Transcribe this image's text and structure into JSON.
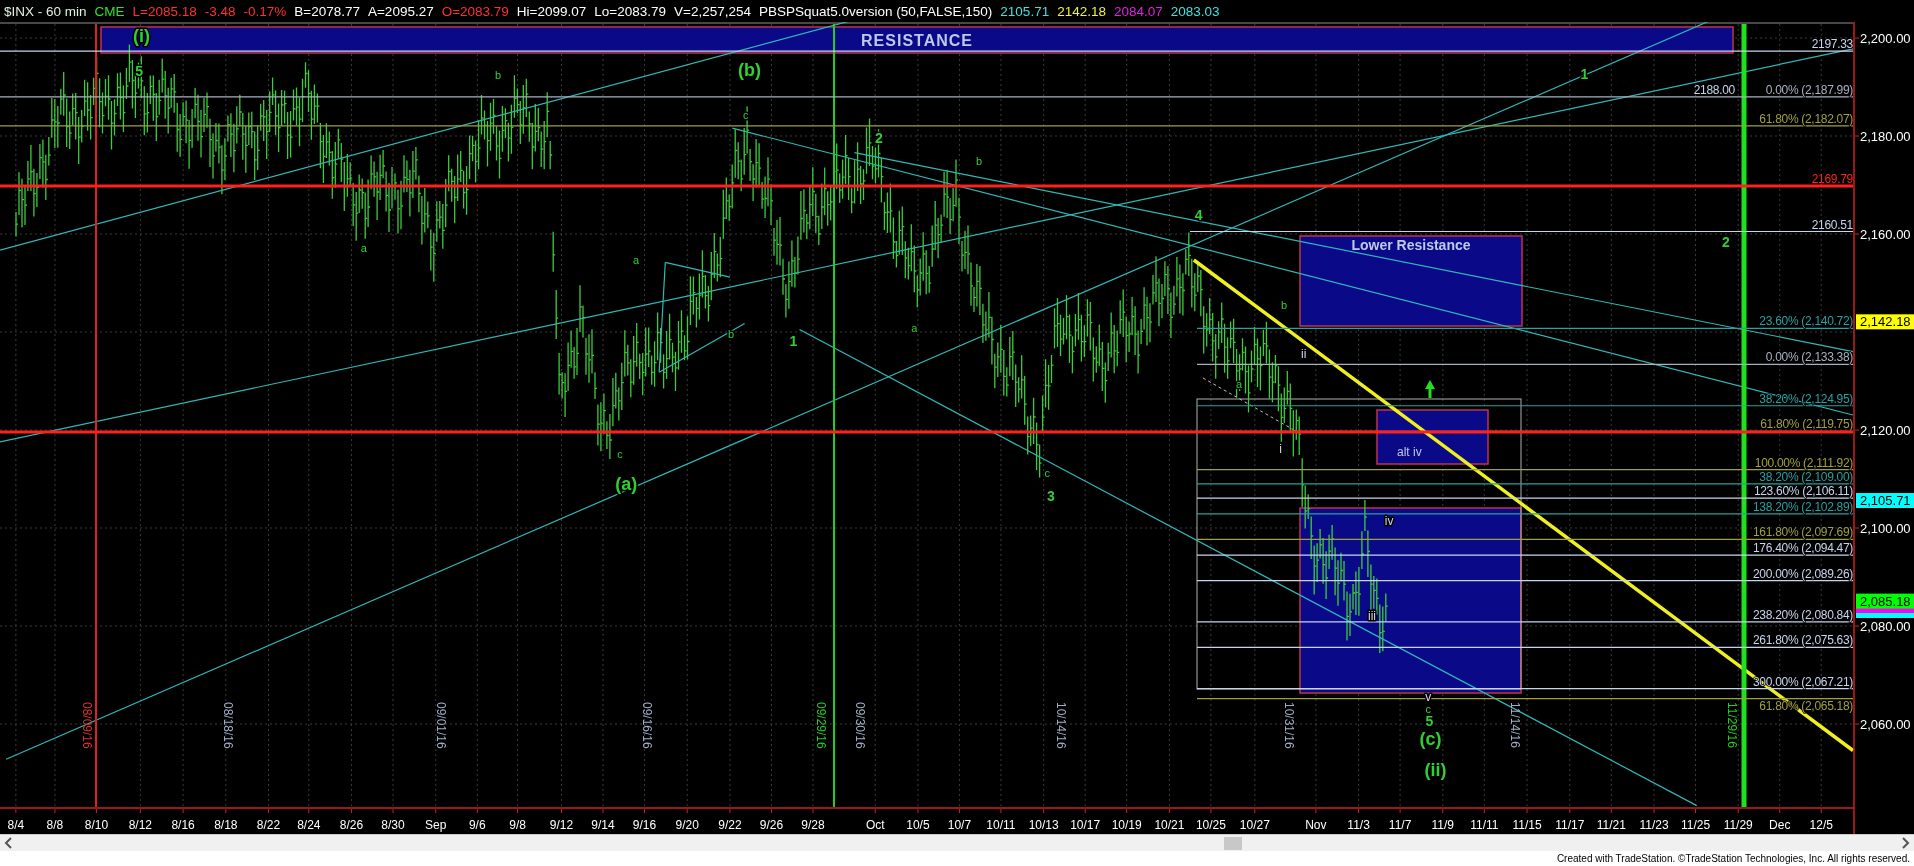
{
  "header": {
    "items": [
      {
        "text": "$INX - 60 min",
        "color": "#e0f0e0"
      },
      {
        "text": "CME",
        "color": "#30e030"
      },
      {
        "text": "L=2085.18",
        "color": "#ff3030"
      },
      {
        "text": "-3.48",
        "color": "#ff3030"
      },
      {
        "text": "-0.17%",
        "color": "#ff3030"
      },
      {
        "text": "B=2078.77",
        "color": "#ffffff"
      },
      {
        "text": "A=2095.27",
        "color": "#ffffff"
      },
      {
        "text": "O=2083.79",
        "color": "#ff3030"
      },
      {
        "text": "Hi=2099.07",
        "color": "#ffffff"
      },
      {
        "text": "Lo=2083.79",
        "color": "#ffffff"
      },
      {
        "text": "V=2,257,254",
        "color": "#ffffff"
      },
      {
        "text": "PBSPSquat5.0version (50,FALSE,150)",
        "color": "#ffffff"
      },
      {
        "text": "2105.71",
        "color": "#40e0e0"
      },
      {
        "text": "2142.18",
        "color": "#f0f040"
      },
      {
        "text": "2084.07",
        "color": "#e020e0"
      },
      {
        "text": "2083.03",
        "color": "#40e0e0"
      }
    ]
  },
  "chart": {
    "zones": [
      {
        "label": "RESISTANCE"
      },
      {
        "label": "Lower Resistance"
      },
      {
        "label": "alt iv"
      }
    ],
    "levels": [
      {
        "label": "2197.33",
        "color": "#c8d4ec"
      },
      {
        "label": "2188.00",
        "color": "#c8d4ec"
      },
      {
        "label": "0.00% (2,187.99)",
        "color": "#a8b0c0"
      },
      {
        "label": "61.80% (2,182.07)",
        "color": "#a0a040"
      },
      {
        "label": "2169.79",
        "color": "#ff2020"
      },
      {
        "label": "2160.51",
        "color": "#c8d4ec"
      },
      {
        "label": "23.60% (2,140.72)",
        "color": "#2aa0a0"
      },
      {
        "label": "0.00% (2,133.38)",
        "color": "#a8b0c0"
      },
      {
        "label": "38.20% (2,124.95)",
        "color": "#2aa0a0"
      },
      {
        "label": "61.80% (2,119.75)",
        "color": "#a0a040"
      },
      {
        "label": "100.00% (2,111.92)",
        "color": "#a0a040"
      },
      {
        "label": "38.20% (2,109.00)",
        "color": "#2aa0a0"
      },
      {
        "label": "123.60% (2,106.11)",
        "color": "#c8d4ec"
      },
      {
        "label": "138.20% (2,102.89)",
        "color": "#2aa0a0"
      },
      {
        "label": "161.80% (2,097.69)",
        "color": "#a0a040"
      },
      {
        "label": "176.40% (2,094.47)",
        "color": "#c8d4ec"
      },
      {
        "label": "200.00% (2,089.26)",
        "color": "#c8d4ec"
      },
      {
        "label": "238.20% (2,080.84)",
        "color": "#c8d4ec"
      },
      {
        "label": "261.80% (2,075.63)",
        "color": "#c8d4ec"
      },
      {
        "label": "300.00% (2,067.21)",
        "color": "#c8d4ec"
      },
      {
        "label": "61.80% (2,065.18)",
        "color": "#a0a040"
      }
    ],
    "wave_labels": [
      {
        "text": "(i)",
        "kind": "large"
      },
      {
        "text": "5",
        "kind": "bold"
      },
      {
        "text": "b",
        "kind": "small"
      },
      {
        "text": "(b)",
        "kind": "large"
      },
      {
        "text": "c",
        "kind": "small"
      },
      {
        "text": "2",
        "kind": "bold"
      },
      {
        "text": "b",
        "kind": "small"
      },
      {
        "text": "4",
        "kind": "bold"
      },
      {
        "text": "a",
        "kind": "small"
      },
      {
        "text": "a",
        "kind": "small"
      },
      {
        "text": "b",
        "kind": "small"
      },
      {
        "text": "1",
        "kind": "bold"
      },
      {
        "text": "a",
        "kind": "small"
      },
      {
        "text": "c",
        "kind": "small"
      },
      {
        "text": "(a)",
        "kind": "large"
      },
      {
        "text": "c",
        "kind": "small"
      },
      {
        "text": "3",
        "kind": "bold"
      },
      {
        "text": "1",
        "kind": "bold"
      },
      {
        "text": "2",
        "kind": "bold"
      },
      {
        "text": "b",
        "kind": "small"
      },
      {
        "text": "a",
        "kind": "small"
      },
      {
        "text": "ii",
        "kind": "roman"
      },
      {
        "text": "i",
        "kind": "roman"
      },
      {
        "text": "iv",
        "kind": "roman"
      },
      {
        "text": "iii",
        "kind": "roman"
      },
      {
        "text": "v",
        "kind": "roman"
      },
      {
        "text": "c",
        "kind": "small"
      },
      {
        "text": "5",
        "kind": "bold"
      },
      {
        "text": "(c)",
        "kind": "large"
      },
      {
        "text": "(ii)",
        "kind": "large"
      }
    ],
    "date_markers": [
      {
        "text": "08/09/16",
        "color": "#e03030"
      },
      {
        "text": "08/18/16",
        "color": "#a0b0c8"
      },
      {
        "text": "09/01/16",
        "color": "#a0b0c8"
      },
      {
        "text": "09/16/16",
        "color": "#a0b0c8"
      },
      {
        "text": "09/29/16",
        "color": "#20d020"
      },
      {
        "text": "09/30/16",
        "color": "#a0b0c8"
      },
      {
        "text": "10/14/16",
        "color": "#a0b0c8"
      },
      {
        "text": "10/31/16",
        "color": "#a0b0c8"
      },
      {
        "text": "11/14/16",
        "color": "#a0b0c8"
      },
      {
        "text": "11/29/16",
        "color": "#20d020"
      }
    ]
  },
  "price_axis": {
    "ticks": [
      "2,200.00",
      "2,180.00",
      "2,160.00",
      "2,120.00",
      "2,100.00",
      "2,080.00",
      "2,060.00"
    ],
    "tags": [
      {
        "text": "2,142.18",
        "color": "#ffff00"
      },
      {
        "text": "2,105.71",
        "color": "#00ffff"
      },
      {
        "text": "2,085.18",
        "color": "#00ff00"
      }
    ],
    "markers": [
      {
        "color": "#ff00ff"
      },
      {
        "color": "#00ffff"
      }
    ]
  },
  "date_axis": {
    "labels": [
      "8/4",
      "8/8",
      "8/10",
      "8/12",
      "8/16",
      "8/18",
      "8/22",
      "8/24",
      "8/26",
      "8/30",
      "Sep",
      "9/6",
      "9/8",
      "9/12",
      "9/14",
      "9/16",
      "9/20",
      "9/22",
      "9/26",
      "9/28",
      "Oct",
      "10/5",
      "10/7",
      "10/11",
      "10/13",
      "10/17",
      "10/19",
      "10/21",
      "10/25",
      "10/27",
      "Nov",
      "11/3",
      "11/7",
      "11/9",
      "11/11",
      "11/15",
      "11/17",
      "11/21",
      "11/23",
      "11/25",
      "11/29",
      "Dec",
      "12/5"
    ]
  },
  "footer": "Created with TradeStation. ©TradeStation Technologies, Inc. All rights reserved."
}
